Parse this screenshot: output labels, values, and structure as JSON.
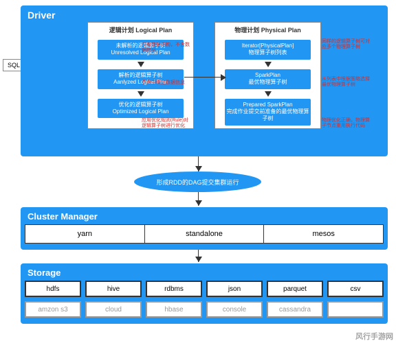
{
  "driver": {
    "title": "Driver",
    "sql_label": "SQL",
    "logical": {
      "title": "逻辑计划 Logical Plan",
      "steps": [
        {
          "line1": "未解析的逻辑算子树",
          "line2": "Unresolved Logical Plan",
          "anno": "仅有数据结构，不含数据信息"
        },
        {
          "line1": "解析的逻辑算子树",
          "line2": "Aanlyzed Logical Plan",
          "anno": "节点中绑定数据信息"
        },
        {
          "line1": "优化的逻辑算子树",
          "line2": "Optimized Logical Plan",
          "anno": "应用优化规则(Rule)对逻辑算子树进行优化"
        }
      ]
    },
    "physical": {
      "title": "物理计划 Physical Plan",
      "steps": [
        {
          "line1": "Iterator[PhysicalPlan]",
          "line2": "物理算子树列表",
          "anno": "同样的逻辑算子树可对应多个物理算子树"
        },
        {
          "line1": "SparkPlan",
          "line2": "最优物理算子树",
          "anno": "从列表中根据策略选择最优物理算子树"
        },
        {
          "line1": "Prepared SparkPlan",
          "line2": "完成作业提交前准备的最优物理算子树",
          "anno": "物理优化正确，物理算子节点重用执行代码"
        }
      ]
    }
  },
  "dag": {
    "text": "形成RDD的DAG提交集群运行"
  },
  "cluster": {
    "title": "Cluster Manager",
    "items": [
      "yarn",
      "standalone",
      "mesos"
    ]
  },
  "storage": {
    "title": "Storage",
    "row1": [
      "hdfs",
      "hive",
      "rdbms",
      "json",
      "parquet",
      "csv"
    ],
    "row2": [
      "amzon s3",
      "cloud",
      "hbase",
      "console",
      "cassandra",
      ""
    ]
  },
  "watermark": "风行手游网"
}
